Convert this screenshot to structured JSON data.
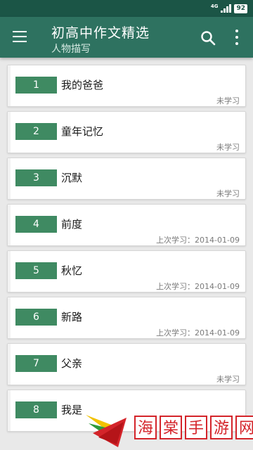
{
  "status_bar": {
    "network": "4G",
    "battery": "92"
  },
  "app_bar": {
    "title": "初高中作文精选",
    "subtitle": "人物描写"
  },
  "items": [
    {
      "number": "1",
      "title": "我的爸爸",
      "status": "未学习"
    },
    {
      "number": "2",
      "title": "童年记忆",
      "status": "未学习"
    },
    {
      "number": "3",
      "title": "沉默",
      "status": "未学习"
    },
    {
      "number": "4",
      "title": "前度",
      "status": "上次学习：2014-01-09"
    },
    {
      "number": "5",
      "title": "秋忆",
      "status": "上次学习：2014-01-09"
    },
    {
      "number": "6",
      "title": "新路",
      "status": "上次学习：2014-01-09"
    },
    {
      "number": "7",
      "title": "父亲",
      "status": "未学习"
    },
    {
      "number": "8",
      "title": "我是",
      "status": ""
    }
  ],
  "watermark": {
    "chars": [
      "海",
      "棠",
      "手",
      "游",
      "网"
    ]
  },
  "colors": {
    "status_bar": "#1b5546",
    "app_bar": "#2e7260",
    "number_badge": "#3f8a62",
    "watermark_red": "#d4242a"
  }
}
